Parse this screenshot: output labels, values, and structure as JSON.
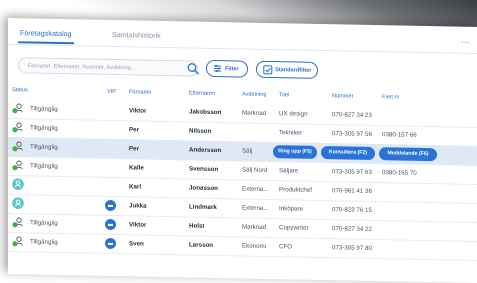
{
  "tabs": [
    {
      "label": "Företagskatalog",
      "active": true
    },
    {
      "label": "Samtalshistorik",
      "active": false
    }
  ],
  "more_label": "...",
  "toolbar": {
    "search_placeholder": "Förnamn, Efternamn, Nummer, Avdelning...",
    "filter_label": "Filter",
    "standard_filter_label": "Standardfilter"
  },
  "columns": [
    "Status",
    "VIP",
    "Förnamn",
    "Efternamn",
    "Avdelning",
    "Titel",
    "Nummer",
    "Fast nr"
  ],
  "rows": [
    {
      "status": "Tillgänglig",
      "avatar": "available",
      "vip": false,
      "first": "Viktor",
      "last": "Jakobsson",
      "dept": "Marknad",
      "title": "UX design",
      "number": "070-827 34 23",
      "fixed": ""
    },
    {
      "status": "Tillgänglig",
      "avatar": "available",
      "vip": false,
      "first": "Per",
      "last": "Nilsson",
      "dept": "",
      "title": "Tekniker",
      "number": "073-305 97 56",
      "fixed": "0380-157 66"
    },
    {
      "status": "Tillgänglig",
      "avatar": "available",
      "vip": false,
      "first": "Per",
      "last": "Andersson",
      "dept": "Sälj",
      "title": "Säljare",
      "number": "",
      "fixed": "",
      "selected": true
    },
    {
      "status": "Tillgänglig",
      "avatar": "available",
      "vip": false,
      "first": "Kalle",
      "last": "Svensson",
      "dept": "Sälj Nord",
      "title": "Säljare",
      "number": "073-305 97 63",
      "fixed": "0380-165 70"
    },
    {
      "status": "",
      "avatar": "unknown",
      "vip": false,
      "first": "Karl",
      "last": "Jonasson",
      "dept": "Externa...",
      "title": "Produktchef",
      "number": "070-961 41 36",
      "fixed": ""
    },
    {
      "status": "",
      "avatar": "unknown",
      "vip": true,
      "first": "Jukka",
      "last": "Lindmark",
      "dept": "Externa...",
      "title": "Inköpare",
      "number": "070-823 76 15",
      "fixed": ""
    },
    {
      "status": "Tillgänglig",
      "avatar": "available",
      "vip": true,
      "first": "Viktor",
      "last": "Holst",
      "dept": "Marknad",
      "title": "Copywriter",
      "number": "070-827 34 22",
      "fixed": ""
    },
    {
      "status": "Tillgänglig",
      "avatar": "available",
      "vip": true,
      "first": "Sven",
      "last": "Larsson",
      "dept": "Ekonomi",
      "title": "CFO",
      "number": "073-305 97 80",
      "fixed": ""
    }
  ],
  "row_actions": [
    {
      "label": "Ring upp (F5)"
    },
    {
      "label": "Konsultera (F2)"
    },
    {
      "label": "Meddelande (F6)"
    }
  ],
  "colors": {
    "accent": "#2a6fcd",
    "available": "#3bb54a",
    "unknown": "#5ec7c5",
    "selected_row": "#dfe9f6"
  }
}
